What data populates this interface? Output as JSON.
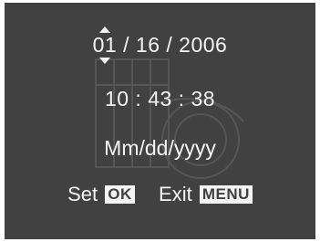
{
  "date": {
    "month": "01",
    "separator1": " / ",
    "day": "16",
    "separator2": " / ",
    "year": "2006",
    "selection_indicator_icon": "up-down-arrows-icon"
  },
  "time": {
    "text": "10 : 43 : 38"
  },
  "date_format": {
    "text": "Mm/dd/yyyy"
  },
  "controls": {
    "set_label": "Set",
    "set_key": "OK",
    "exit_label": "Exit",
    "exit_key": "MENU"
  },
  "colors": {
    "screen_background": "#414141",
    "text": "#f4f4f4"
  }
}
